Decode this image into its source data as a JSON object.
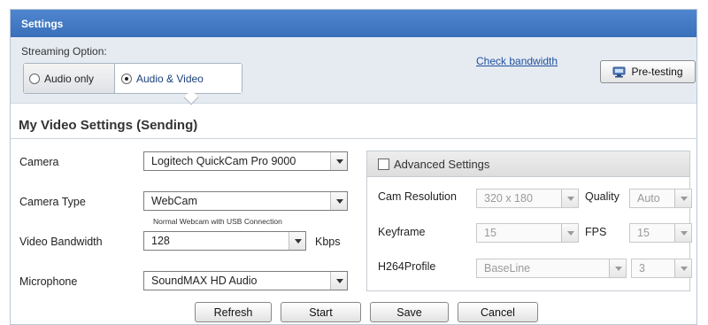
{
  "window": {
    "title": "Settings"
  },
  "streaming": {
    "label": "Streaming Option:",
    "options": [
      "Audio only",
      "Audio & Video"
    ],
    "selected": "Audio & Video"
  },
  "links": {
    "check_bandwidth": "Check bandwidth"
  },
  "pretest": {
    "label": "Pre-testing",
    "icon": "monitor-icon"
  },
  "section": {
    "title": "My Video Settings (Sending)"
  },
  "fields": {
    "camera": {
      "label": "Camera",
      "value": "Logitech QuickCam Pro 9000"
    },
    "camera_type": {
      "label": "Camera Type",
      "value": "WebCam",
      "hint": "Normal Webcam with USB Connection"
    },
    "video_bandwidth": {
      "label": "Video Bandwidth",
      "value": "128",
      "unit": "Kbps"
    },
    "microphone": {
      "label": "Microphone",
      "value": "SoundMAX HD Audio"
    }
  },
  "advanced": {
    "title": "Advanced Settings",
    "checked": false,
    "cam_resolution": {
      "label": "Cam Resolution",
      "value": "320 x 180"
    },
    "quality": {
      "label": "Quality",
      "value": "Auto"
    },
    "keyframe": {
      "label": "Keyframe",
      "value": "15"
    },
    "fps": {
      "label": "FPS",
      "value": "15"
    },
    "h264profile": {
      "label": "H264Profile",
      "value": "BaseLine",
      "level": "3"
    }
  },
  "buttons": {
    "refresh": "Refresh",
    "start": "Start",
    "save": "Save",
    "cancel": "Cancel"
  },
  "colors": {
    "titlebar": "#3f77c4",
    "link": "#1f4f9e",
    "panel_bg": "#e6ebf1"
  }
}
